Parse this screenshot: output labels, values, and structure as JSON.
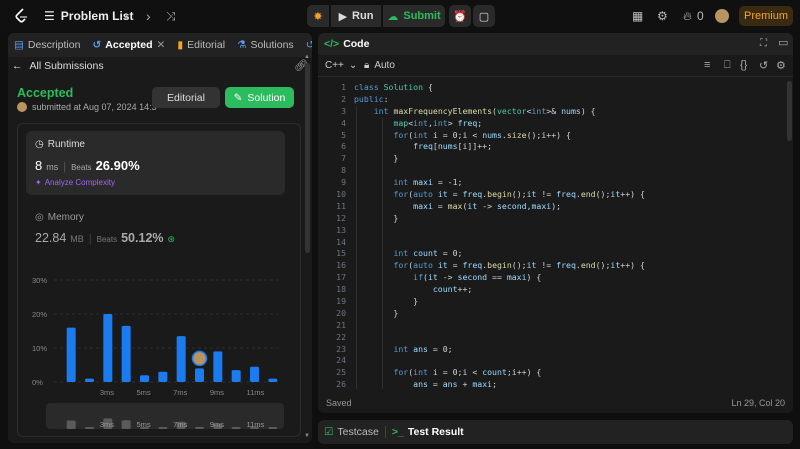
{
  "topbar": {
    "problem_list": "Problem List",
    "run": "Run",
    "submit": "Submit",
    "streak": "0",
    "premium": "Premium"
  },
  "left": {
    "tabs": [
      {
        "label": "Description"
      },
      {
        "label": "Accepted"
      },
      {
        "label": "Editorial"
      },
      {
        "label": "Solutions"
      },
      {
        "label": "Su"
      }
    ],
    "back_label": "All Submissions",
    "status": "Accepted",
    "submitted": "submitted at Aug 07, 2024 14:3",
    "editorial_btn": "Editorial",
    "solution_btn": "Solution",
    "runtime": {
      "title": "Runtime",
      "value": "8",
      "unit": "ms",
      "beats_label": "Beats",
      "beats": "26.90%",
      "analyze": "Analyze Complexity"
    },
    "memory": {
      "title": "Memory",
      "value": "22.84",
      "unit": "MB",
      "beats_label": "Beats",
      "beats": "50.12%"
    }
  },
  "chart_data": {
    "type": "bar",
    "ylim": [
      0,
      30
    ],
    "yticks": [
      "30%",
      "20%",
      "10%",
      "0%"
    ],
    "xticks": [
      "3ms",
      "5ms",
      "7ms",
      "9ms",
      "11ms"
    ],
    "values": [
      16,
      1,
      20,
      16.5,
      2,
      3,
      13.5,
      4,
      9,
      3.5,
      4.5,
      1
    ],
    "highlight_index": 7,
    "mini_xticks": [
      "3ms",
      "5ms",
      "7ms",
      "9ms",
      "11ms"
    ],
    "colors": {
      "bar": "#1a7cf0",
      "mini": "#5a5a5a"
    }
  },
  "code": {
    "title": "Code",
    "language": "C++",
    "auto": "Auto",
    "saved": "Saved",
    "position": "Ln 29, Col 20",
    "lines": [
      "class Solution {",
      "public:",
      "    int maxFrequencyElements(vector<int>& nums) {",
      "        map<int,int> freq;",
      "        for(int i = 0;i < nums.size();i++) {",
      "            freq[nums[i]]++;",
      "        }",
      "",
      "        int maxi = -1;",
      "        for(auto it = freq.begin();it != freq.end();it++) {",
      "            maxi = max(it -> second,maxi);",
      "        }",
      "",
      "",
      "        int count = 0;",
      "        for(auto it = freq.begin();it != freq.end();it++) {",
      "            if(it -> second == maxi) {",
      "                count++;",
      "            }",
      "        }",
      "",
      "",
      "        int ans = 0;",
      "",
      "        for(int i = 0;i < count;i++) {",
      "            ans = ans + maxi;"
    ]
  },
  "bottom": {
    "testcase": "Testcase",
    "test_result": "Test Result"
  }
}
